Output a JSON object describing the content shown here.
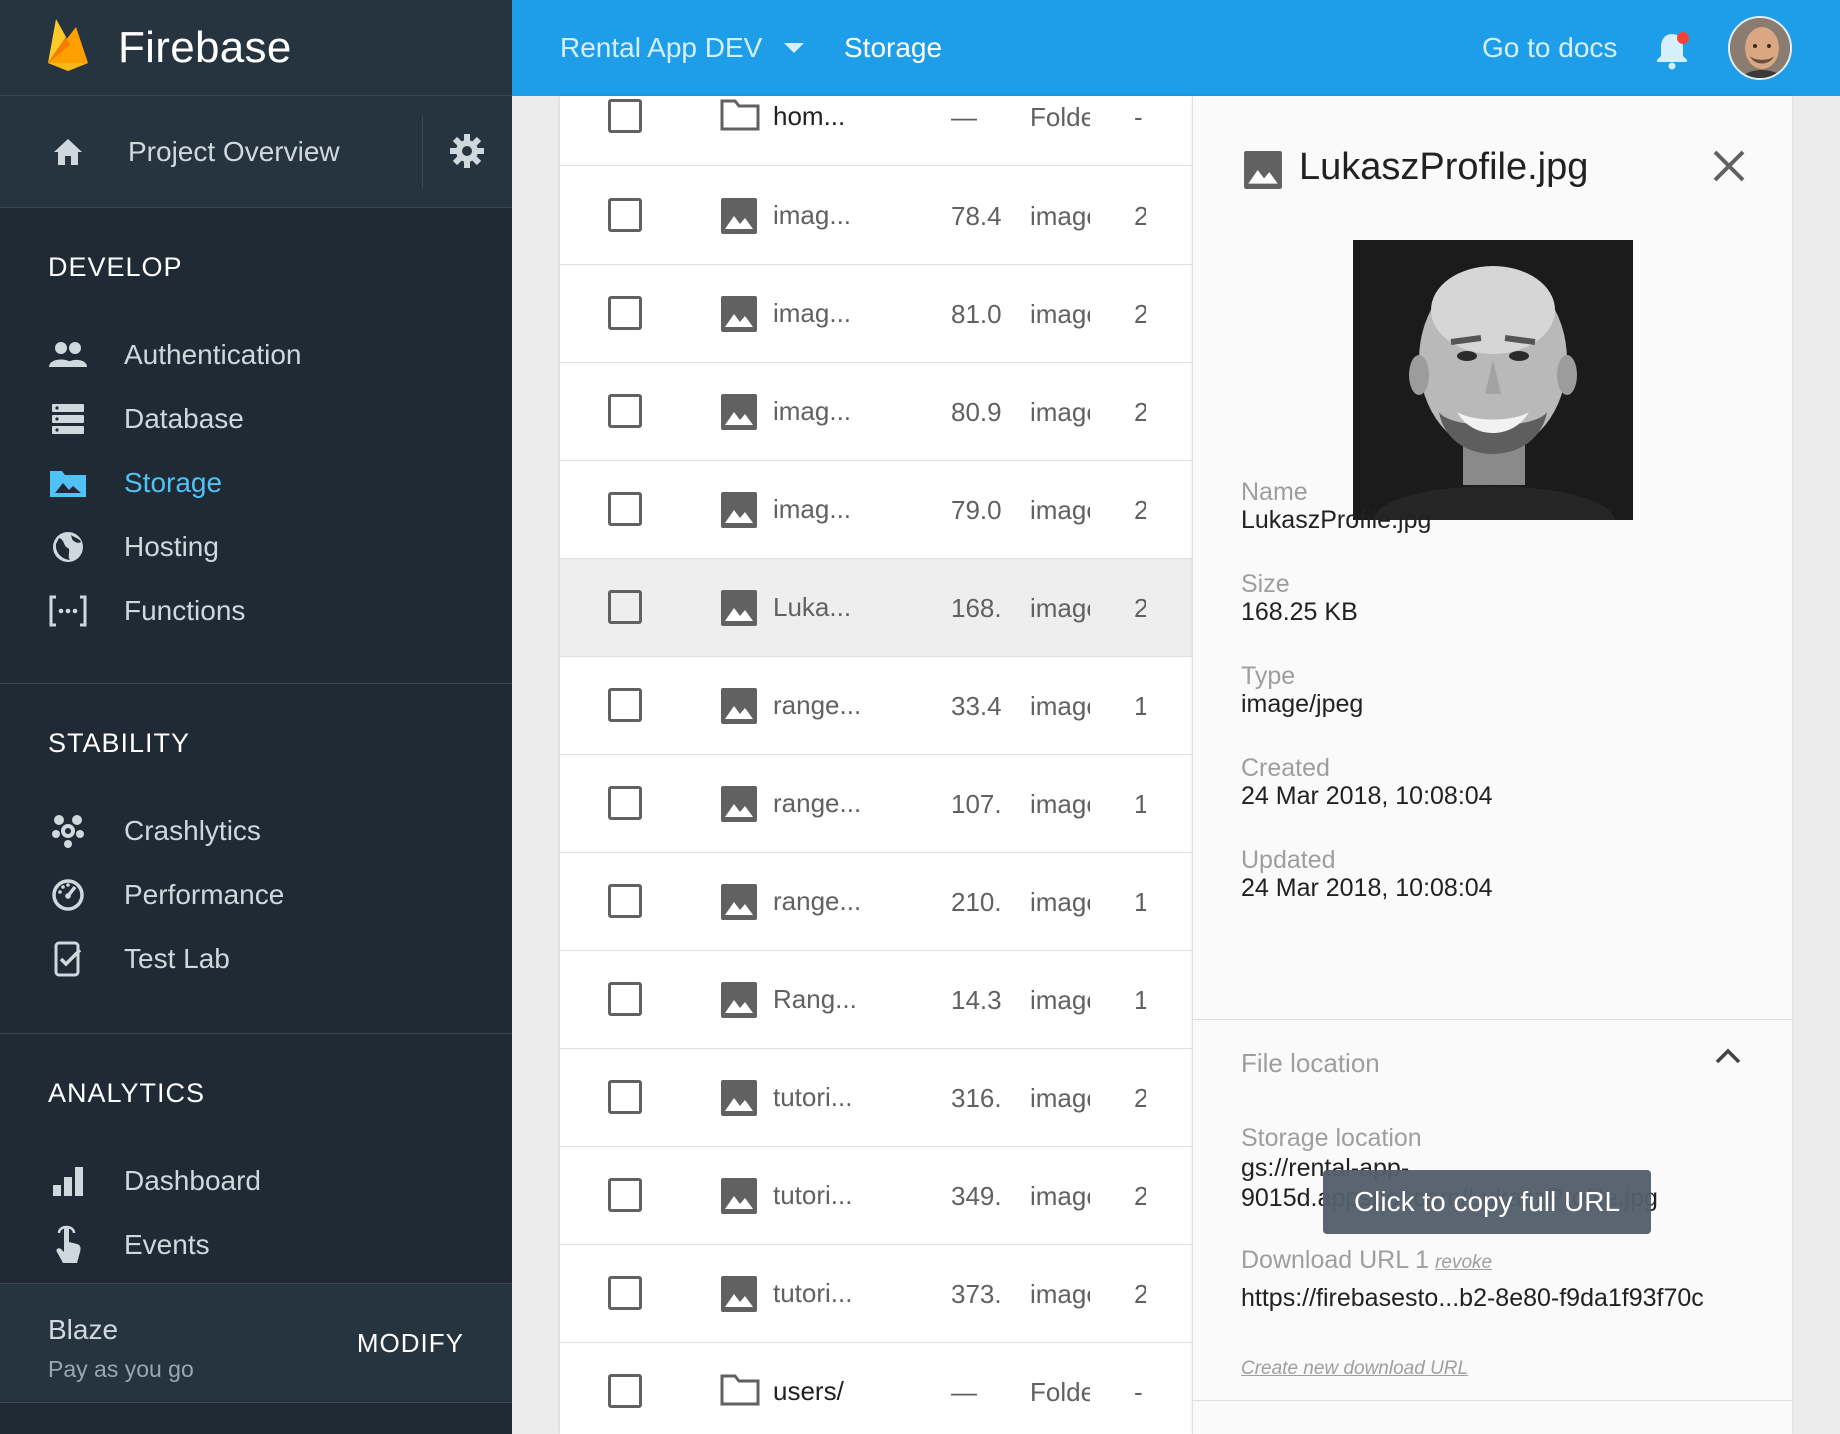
{
  "brand": {
    "title": "Firebase"
  },
  "sidebar": {
    "overview_label": "Project Overview",
    "sections": [
      {
        "title": "DEVELOP",
        "items": [
          {
            "label": "Authentication",
            "icon": "people-icon"
          },
          {
            "label": "Database",
            "icon": "database-icon"
          },
          {
            "label": "Storage",
            "icon": "storage-icon",
            "active": true
          },
          {
            "label": "Hosting",
            "icon": "globe-icon"
          },
          {
            "label": "Functions",
            "icon": "functions-icon"
          }
        ]
      },
      {
        "title": "STABILITY",
        "items": [
          {
            "label": "Crashlytics",
            "icon": "crashlytics-icon"
          },
          {
            "label": "Performance",
            "icon": "speedometer-icon"
          },
          {
            "label": "Test Lab",
            "icon": "test-lab-icon"
          }
        ]
      },
      {
        "title": "ANALYTICS",
        "items": [
          {
            "label": "Dashboard",
            "icon": "bar-chart-icon"
          },
          {
            "label": "Events",
            "icon": "touch-icon"
          }
        ]
      }
    ],
    "plan": {
      "name": "Blaze",
      "subtitle": "Pay as you go",
      "action": "MODIFY"
    }
  },
  "topbar": {
    "project": "Rental App DEV",
    "breadcrumb": "Storage",
    "docs_label": "Go to docs",
    "accent_color": "#1e9ee8",
    "notification_dot_color": "#f44336"
  },
  "files": [
    {
      "name": "hom...",
      "size": "—",
      "type": "Folder",
      "updated": "-",
      "kind": "folder"
    },
    {
      "name": "imag...",
      "size": "78.4",
      "type": "image",
      "updated": "2",
      "kind": "image"
    },
    {
      "name": "imag...",
      "size": "81.0",
      "type": "image",
      "updated": "2",
      "kind": "image"
    },
    {
      "name": "imag...",
      "size": "80.9",
      "type": "image",
      "updated": "2",
      "kind": "image"
    },
    {
      "name": "imag...",
      "size": "79.0",
      "type": "image",
      "updated": "2",
      "kind": "image"
    },
    {
      "name": "Luka...",
      "size": "168.",
      "type": "image",
      "updated": "2",
      "kind": "image",
      "selected": true
    },
    {
      "name": "range...",
      "size": "33.4",
      "type": "image",
      "updated": "1",
      "kind": "image"
    },
    {
      "name": "range...",
      "size": "107.",
      "type": "image",
      "updated": "1",
      "kind": "image"
    },
    {
      "name": "range...",
      "size": "210.",
      "type": "image",
      "updated": "1",
      "kind": "image"
    },
    {
      "name": "Rang...",
      "size": "14.3",
      "type": "image",
      "updated": "1",
      "kind": "image"
    },
    {
      "name": "tutori...",
      "size": "316.",
      "type": "image",
      "updated": "2",
      "kind": "image"
    },
    {
      "name": "tutori...",
      "size": "349.",
      "type": "image",
      "updated": "2",
      "kind": "image"
    },
    {
      "name": "tutori...",
      "size": "373.",
      "type": "image",
      "updated": "2",
      "kind": "image"
    },
    {
      "name": "users/",
      "size": "—",
      "type": "Folder",
      "updated": "-",
      "kind": "folder"
    }
  ],
  "detail": {
    "title": "LukaszProfile.jpg",
    "fields": [
      {
        "label": "Name",
        "value": "LukaszProfile.jpg"
      },
      {
        "label": "Size",
        "value": "168.25 KB"
      },
      {
        "label": "Type",
        "value": "image/jpeg"
      },
      {
        "label": "Created",
        "value": "24 Mar 2018, 10:08:04"
      },
      {
        "label": "Updated",
        "value": "24 Mar 2018, 10:08:04"
      }
    ],
    "location": {
      "title": "File location",
      "storage_label": "Storage location",
      "storage_line1": "gs://rental-app-",
      "storage_line2": "9015d.appspot.com/LukaszProfile.jpg",
      "download_label": "Download URL 1",
      "revoke_label": "revoke",
      "download_url": "https://firebasesto...b2-8e80-f9da1f93f70c",
      "create_link": "Create new download URL"
    },
    "tooltip": "Click to copy full URL"
  }
}
